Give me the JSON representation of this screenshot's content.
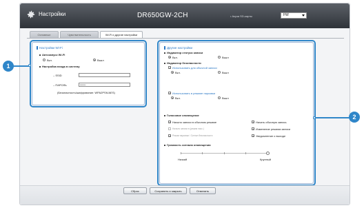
{
  "header": {
    "title": "Настройки",
    "model": "DR650GW-2CH",
    "sd_label": "• Акуза SD-карты",
    "fw_value": "FW"
  },
  "tabs": [
    {
      "label": "Основные",
      "active": false
    },
    {
      "label": "Чувствительность",
      "active": false
    },
    {
      "label": "Wi-Fi и другие настройки",
      "active": true
    }
  ],
  "wifi_panel": {
    "heading": "Настройки Wi-Fi",
    "autostart_label": "Автозапуск Wi-Fi",
    "on_label": "Вкл.",
    "off_label": "Выкл",
    "login_label": "Настройка входа в систему",
    "ssid_label": "SSID",
    "ssid_value": "",
    "password_label": "ПАРОЛЬ",
    "password_value": "••••••••",
    "security_text": "(Безопасность/шифрование: WPA2PSK/AES)"
  },
  "other_panel": {
    "heading": "Другие настройки",
    "rec_status_label": "Индикатор статуса записи",
    "security_indicator_label": "Индикатор безопасности",
    "normal_mode_label": "Использовать для обычной записи",
    "parking_mode_label": "Использовать в режиме парковки",
    "on_label": "Вкл.",
    "off_label": "Выкл",
    "voice_label": "Голосовое оповещение",
    "voice_left": [
      {
        "label": "Начало записи в обычном режиме",
        "checked": true,
        "enabled": true
      },
      {
        "label": "Начало записи в (режим пасс.)",
        "checked": false,
        "enabled": false
      },
      {
        "label": "Режим парковки / Сигнал безопасности",
        "checked": true,
        "enabled": false
      }
    ],
    "voice_right": [
      {
        "label": "Начать обычную запись",
        "checked": true
      },
      {
        "label": "Изменение режима записи",
        "checked": true
      },
      {
        "label": "Уведомление о выходе",
        "checked": true
      }
    ],
    "volume_label": "Громкость сигнала оповещения",
    "volume_min": "Низкий",
    "volume_max": "Крупный",
    "volume_level": 1.0
  },
  "footer": {
    "reset": "Сброс",
    "save_close": "Сохранить и закрыть",
    "cancel": "Отменить"
  },
  "callouts": [
    "1",
    "2"
  ],
  "colors": {
    "accent": "#2f86c9",
    "header": "#3a3f45"
  }
}
